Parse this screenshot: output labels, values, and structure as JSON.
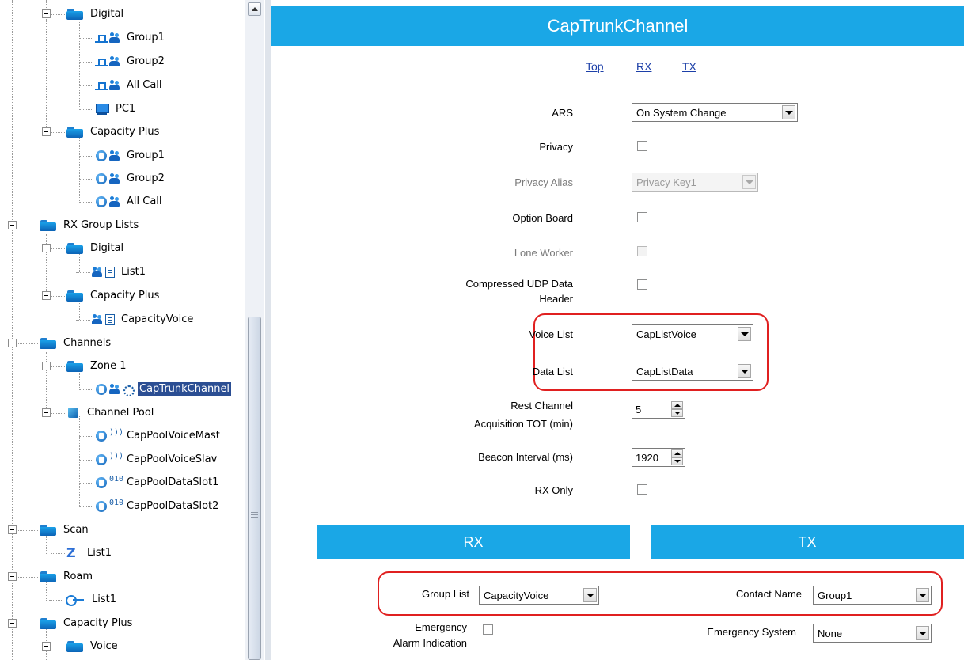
{
  "tree": {
    "nodes": [
      {
        "label": "Digital",
        "icon": "folder-icon"
      },
      {
        "label": "Group1",
        "icon": "digital-group-icon"
      },
      {
        "label": "Group2",
        "icon": "digital-group-icon"
      },
      {
        "label": "All Call",
        "icon": "digital-allcall-icon"
      },
      {
        "label": "PC1",
        "icon": "private-call-icon"
      },
      {
        "label": "Capacity Plus",
        "icon": "folder-icon"
      },
      {
        "label": "Group1",
        "icon": "capplus-group-icon"
      },
      {
        "label": "Group2",
        "icon": "capplus-group-icon"
      },
      {
        "label": "All Call",
        "icon": "capplus-allcall-icon"
      },
      {
        "label": "RX Group Lists",
        "icon": "folder-icon"
      },
      {
        "label": "Digital",
        "icon": "folder-icon"
      },
      {
        "label": "List1",
        "icon": "rx-group-list-icon"
      },
      {
        "label": "Capacity Plus",
        "icon": "folder-icon"
      },
      {
        "label": "CapacityVoice",
        "icon": "rx-group-list-icon"
      },
      {
        "label": "Channels",
        "icon": "folder-icon"
      },
      {
        "label": "Zone 1",
        "icon": "folder-icon"
      },
      {
        "label": "CapTrunkChannel",
        "icon": "trunk-channel-icon"
      },
      {
        "label": "Channel Pool",
        "icon": "channel-pool-icon"
      },
      {
        "label": "CapPoolVoiceMast",
        "icon": "voice-channel-icon"
      },
      {
        "label": "CapPoolVoiceSlav",
        "icon": "voice-channel-icon"
      },
      {
        "label": "CapPoolDataSlot1",
        "icon": "data-channel-icon"
      },
      {
        "label": "CapPoolDataSlot2",
        "icon": "data-channel-icon"
      },
      {
        "label": "Scan",
        "icon": "folder-icon"
      },
      {
        "label": "List1",
        "icon": "scan-list-icon"
      },
      {
        "label": "Roam",
        "icon": "folder-icon"
      },
      {
        "label": "List1",
        "icon": "roam-list-icon"
      },
      {
        "label": "Capacity Plus",
        "icon": "folder-icon"
      },
      {
        "label": "Voice",
        "icon": "folder-icon"
      }
    ],
    "selected": "CapTrunkChannel"
  },
  "panel": {
    "title": "CapTrunkChannel",
    "nav": {
      "top": "Top",
      "rx": "RX",
      "tx": "TX"
    },
    "fields": {
      "ars": {
        "label": "ARS",
        "value": "On System Change"
      },
      "privacy": {
        "label": "Privacy",
        "checked": false
      },
      "privacy_alias": {
        "label": "Privacy Alias",
        "value": "Privacy Key1"
      },
      "option_board": {
        "label": "Option Board",
        "checked": false
      },
      "lone_worker": {
        "label": "Lone Worker",
        "checked": false
      },
      "compressed_udp_1": "Compressed UDP Data",
      "compressed_udp_2": "Header",
      "voice_list": {
        "label": "Voice List",
        "value": "CapListVoice"
      },
      "data_list": {
        "label": "Data List",
        "value": "CapListData"
      },
      "rest_channel_1": "Rest Channel",
      "rest_channel_2": "Acquisition TOT (min)",
      "rest_channel_value": "5",
      "beacon_interval": {
        "label": "Beacon Interval (ms)",
        "value": "1920"
      },
      "rx_only": {
        "label": "RX Only",
        "checked": false
      }
    },
    "sections": {
      "rx": "RX",
      "tx": "TX"
    },
    "rx": {
      "group_list": {
        "label": "Group List",
        "value": "CapacityVoice"
      },
      "emergency_alarm_1": "Emergency",
      "emergency_alarm_2": "Alarm Indication"
    },
    "tx": {
      "contact_name": {
        "label": "Contact Name",
        "value": "Group1"
      },
      "emergency_system": {
        "label": "Emergency System",
        "value": "None"
      }
    }
  },
  "colors": {
    "header": "#1aa7e6",
    "selection": "#2b4e93",
    "highlight": "#e02020",
    "link": "#1c3fa8"
  }
}
